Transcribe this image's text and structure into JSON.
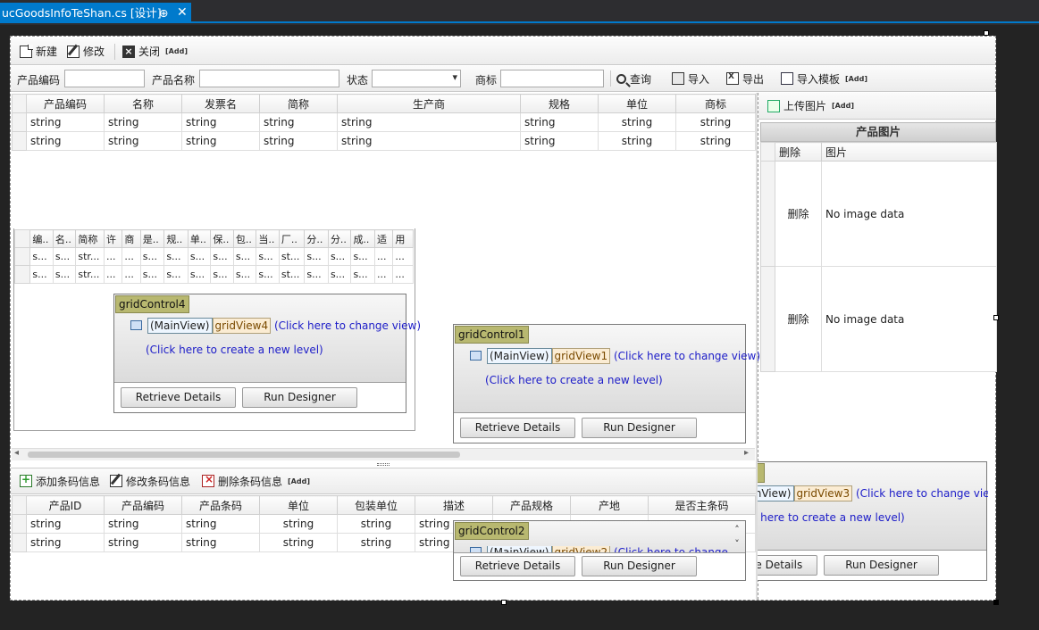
{
  "tab": {
    "title": "ucGoodsInfoTeShan.cs [设计]",
    "pin": "⊕",
    "close": "✕"
  },
  "toolbar1": {
    "new": "新建",
    "edit": "修改",
    "close": "关闭",
    "add": "[Add]"
  },
  "filter": {
    "code_label": "产品编码",
    "name_label": "产品名称",
    "status_label": "状态",
    "brand_label": "商标",
    "query": "查询",
    "import": "导入",
    "export": "导出",
    "import_template": "导入模板",
    "add": "[Add]"
  },
  "right_panel": {
    "upload": "上传图片",
    "add": "[Add]",
    "title": "产品图片",
    "headers": [
      "删除",
      "图片"
    ],
    "rows": [
      {
        "del": "删除",
        "img": "No image data"
      },
      {
        "del": "删除",
        "img": "No image data"
      }
    ]
  },
  "main_grid": {
    "headers": [
      "产品编码",
      "名称",
      "发票名",
      "简称",
      "生产商",
      "规格",
      "单位",
      "商标"
    ],
    "rows": [
      [
        "string",
        "string",
        "string",
        "string",
        "string",
        "string",
        "string",
        "string"
      ],
      [
        "string",
        "string",
        "string",
        "string",
        "string",
        "string",
        "string",
        "string"
      ]
    ]
  },
  "small_grid": {
    "headers": [
      "编..",
      "名..",
      "简称",
      "许",
      "商",
      "是..",
      "规..",
      "单..",
      "保..",
      "包..",
      "当..",
      "厂..",
      "分..",
      "分..",
      "成..",
      "适",
      "用"
    ],
    "rows": [
      [
        "s...",
        "s...",
        "str...",
        "...",
        "...",
        "s...",
        "s...",
        "s...",
        "s...",
        "s...",
        "s...",
        "st...",
        "s...",
        "s...",
        "s...",
        "...",
        "..."
      ],
      [
        "s...",
        "s...",
        "str...",
        "...",
        "...",
        "s...",
        "s...",
        "s...",
        "s...",
        "s...",
        "s...",
        "st...",
        "s...",
        "s...",
        "s...",
        "...",
        "..."
      ]
    ]
  },
  "grid_controls": {
    "gc4": {
      "title": "gridControl4",
      "main_view": "(MainView)",
      "grid_view": "gridView4",
      "change": "(Click here to change view)",
      "create": "(Click here to create a new level)"
    },
    "gc1": {
      "title": "gridControl1",
      "main_view": "(MainView)",
      "grid_view": "gridView1",
      "change": "(Click here to change view)",
      "create": "(Click here to create a new level)"
    },
    "gc2": {
      "title": "gridControl2",
      "main_view": "(MainView)",
      "grid_view": "gridView2",
      "change": "(Click here to change view)"
    },
    "gc3": {
      "main_view": "(MainView)",
      "grid_view": "gridView3",
      "change": "(Click here to change view)",
      "create": "(Click here to create a new level)"
    },
    "retrieve": "Retrieve Details",
    "run": "Run Designer"
  },
  "toolbar2": {
    "add": "添加条码信息",
    "edit": "修改条码信息",
    "delete": "删除条码信息",
    "add_tag": "[Add]"
  },
  "barcode_grid": {
    "headers": [
      "产品ID",
      "产品编码",
      "产品条码",
      "单位",
      "包装单位",
      "描述",
      "产品规格",
      "产地",
      "是否主条码"
    ],
    "rows": [
      [
        "string",
        "string",
        "string",
        "string",
        "string",
        "string"
      ],
      [
        "string",
        "string",
        "string",
        "string",
        "string",
        "string"
      ]
    ]
  }
}
